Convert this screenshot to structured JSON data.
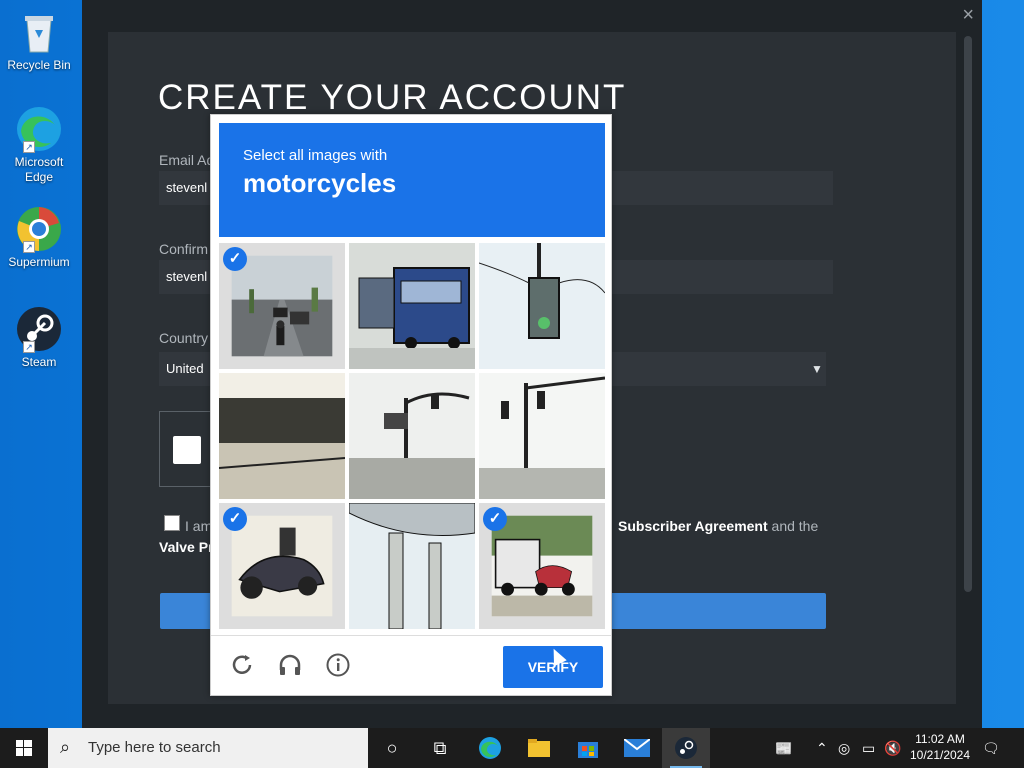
{
  "desktop": {
    "icons": [
      {
        "label": "Recycle Bin"
      },
      {
        "label": "Microsoft Edge"
      },
      {
        "label": "Supermium"
      },
      {
        "label": "Steam"
      }
    ]
  },
  "steam": {
    "close_glyph": "×",
    "title": "CREATE YOUR ACCOUNT",
    "email_label": "Email Ad",
    "email_value": "stevenl",
    "confirm_label": "Confirm",
    "confirm_value": "stevenl",
    "country_label": "Country",
    "country_value": "United",
    "agree_prefix": "I am",
    "agree_link": "Subscriber Agreement",
    "agree_suffix": " and the",
    "agree_line2": "Valve Pr"
  },
  "recaptcha": {
    "instruction": "Select all images with",
    "target": "motorcycles",
    "tiles": [
      {
        "selected": true
      },
      {
        "selected": false
      },
      {
        "selected": false
      },
      {
        "selected": false
      },
      {
        "selected": false
      },
      {
        "selected": false
      },
      {
        "selected": true
      },
      {
        "selected": false
      },
      {
        "selected": true
      }
    ],
    "verify_label": "VERIFY",
    "icons": [
      "reload-icon",
      "headphones-icon",
      "info-icon"
    ]
  },
  "taskbar": {
    "search_placeholder": "Type here to search",
    "time": "11:02 AM",
    "date": "10/21/2024"
  },
  "colors": {
    "recaptcha_blue": "#1a73e8",
    "steam_bg": "#1f2428",
    "desktop_blue": "#0a78d7"
  }
}
